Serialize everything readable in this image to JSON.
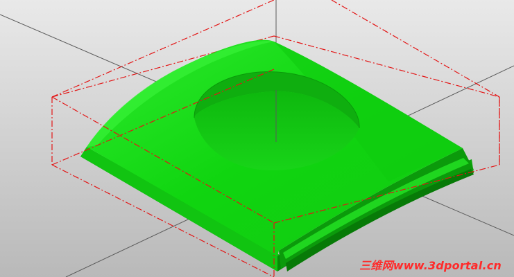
{
  "viewport": {
    "background_top": "#e9e9e9",
    "background_bottom": "#b9b9b9",
    "axis_color": "#5a5a5a",
    "bbox_color": "#e31515",
    "model_color_light": "#32f232",
    "model_color_main": "#10d510",
    "model_color_dark": "#0ca20c",
    "model_color_darker": "#077a07"
  },
  "watermark": {
    "text": "三维网www.3dportal.cn",
    "color": "#ff2a2a"
  }
}
